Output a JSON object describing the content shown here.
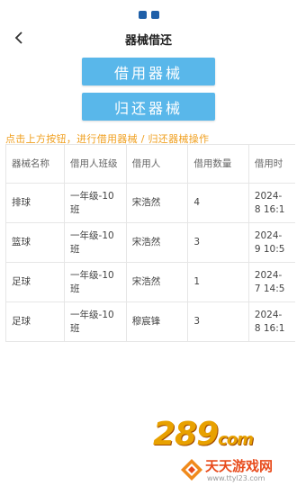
{
  "header": {
    "title": "器械借还"
  },
  "actions": {
    "borrow_label": "借用器械",
    "return_label": "归还器械"
  },
  "hint": "点击上方按钮，进行借用器械 / 归还器械操作",
  "table": {
    "headers": [
      "器械名称",
      "借用人班级",
      "借用人",
      "借用数量",
      "借用时"
    ],
    "rows": [
      [
        "排球",
        "一年级-10班",
        "宋浩然",
        "4",
        "2024-\n8 16:1"
      ],
      [
        "篮球",
        "一年级-10班",
        "宋浩然",
        "3",
        "2024-\n9 10:5"
      ],
      [
        "足球",
        "一年级-10班",
        "宋浩然",
        "1",
        "2024-\n7 14:5"
      ],
      [
        "足球",
        "一年级-10班",
        "穆宸锋",
        "3",
        "2024-\n8 16:1"
      ]
    ]
  },
  "watermark": {
    "brand": "289",
    "brand_suffix": "com",
    "site_name": "天天游戏网",
    "site_url": "www.ttyl23.com"
  },
  "colors": {
    "button": "#59b7ea",
    "hint": "#f0a020",
    "accent": "#1f5fa8"
  },
  "icons": {
    "back": "chevron-left-icon"
  }
}
